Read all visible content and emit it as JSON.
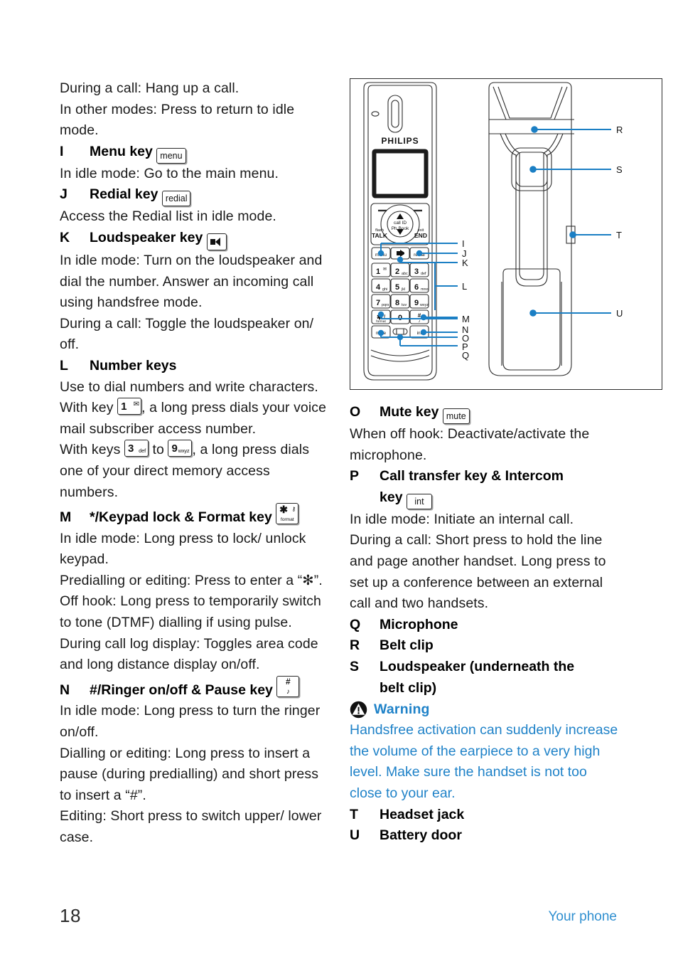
{
  "page": {
    "number": "18",
    "footer_section": "Your phone",
    "accent_blue": "#1f82c8",
    "footer_blue": "#2f8fd0"
  },
  "left_column": {
    "intro": [
      "During a call: Hang up a call.",
      "In other modes: Press to return to idle mode."
    ],
    "entries": [
      {
        "letter": "I",
        "title": "Menu key",
        "key_label": "menu",
        "key_type": "word",
        "body": [
          "In idle mode: Go to the main menu."
        ]
      },
      {
        "letter": "J",
        "title": "Redial key",
        "key_label": "redial",
        "key_type": "word",
        "body": [
          "Access the Redial list in idle mode."
        ]
      },
      {
        "letter": "K",
        "title": "Loudspeaker key",
        "key_label": "speaker-icon",
        "key_type": "speaker",
        "body": [
          "In idle mode: Turn on the loudspeaker and dial the number. Answer an incoming call using handsfree mode.",
          "During a call: Toggle the loudspeaker on/ off."
        ]
      },
      {
        "letter": "L",
        "title": "Number keys",
        "key_label": "",
        "key_type": "none",
        "body": [
          "Use to dial numbers and write characters."
        ],
        "rich": {
          "line1_a": "With key",
          "line1_b": ", a long press dials your voice mail subscriber access number.",
          "key1_digit": "1",
          "key1_sub": "voicemail-envelope",
          "line2_a": "With keys",
          "line2_mid": "to",
          "line2_b": ", a long press dials one of your direct memory access numbers.",
          "key3_digit": "3",
          "key3_sub": "def",
          "key9_digit": "9",
          "key9_sub": "wxyz"
        }
      },
      {
        "letter": "M",
        "title": "*/Keypad lock & Format key",
        "key_label": "format",
        "key_type": "star-format",
        "key_star": "✱",
        "body": [
          "In idle mode: Long press to lock/ unlock keypad.",
          "Predialling or editing: Press to enter a “✻”.",
          "Off hook: Long press to temporarily switch to tone (DTMF) dialling if using pulse.",
          "During call log display: Toggles area code and long distance display on/off."
        ]
      },
      {
        "letter": "N",
        "title": "#/Ringer on/off & Pause key",
        "key_label": "#",
        "key_type": "hash-bell",
        "body": [
          "In idle mode: Long press to turn the ringer on/off.",
          "Dialling or editing: Long press to insert a pause (during predialling) and short press to insert a “#”.",
          "Editing: Short press to switch upper/ lower case."
        ]
      }
    ]
  },
  "right_column": {
    "entries": [
      {
        "letter": "O",
        "title": "Mute key",
        "key_label": "mute",
        "key_type": "word",
        "body": [
          "When off hook: Deactivate/activate the microphone."
        ]
      },
      {
        "letter": "P",
        "title": "Call transfer key & Intercom",
        "title_line2": "key",
        "key_label": "int",
        "key_type": "word",
        "body": [
          "In idle mode: Initiate an internal call.",
          "During a call: Short press to hold the line and page another handset. Long press to set up a conference between an external call and two handsets."
        ]
      },
      {
        "letter": "Q",
        "title": "Microphone",
        "key_type": "none",
        "body": []
      },
      {
        "letter": "R",
        "title": "Belt clip",
        "key_type": "none",
        "body": []
      },
      {
        "letter": "S",
        "title": "Loudspeaker (underneath the",
        "title_line2": "belt clip)",
        "key_type": "none",
        "body": []
      }
    ],
    "warning": {
      "icon": "warning-triangle-icon",
      "title": "Warning",
      "text": "Handsfree activation can suddenly increase the volume of the earpiece to a very high level. Make sure the handset is not too close to your ear."
    },
    "entries_after_warning": [
      {
        "letter": "T",
        "title": "Headset jack"
      },
      {
        "letter": "U",
        "title": "Battery door"
      }
    ]
  },
  "figure": {
    "brand": "PHILIPS",
    "soft_keys": {
      "left": "flash TALK",
      "right": "exit END"
    },
    "nav_labels": {
      "up": "call ID",
      "down": "Ph.Book"
    },
    "function_row": [
      "menu",
      "speaker-icon",
      "redial"
    ],
    "keypad": [
      {
        "digit": "1",
        "sub": "envelope"
      },
      {
        "digit": "2",
        "sub": "abc"
      },
      {
        "digit": "3",
        "sub": "def"
      },
      {
        "digit": "4",
        "sub": "ghi"
      },
      {
        "digit": "5",
        "sub": "jkl"
      },
      {
        "digit": "6",
        "sub": "mno"
      },
      {
        "digit": "7",
        "sub": "pqrs"
      },
      {
        "digit": "8",
        "sub": "tuv"
      },
      {
        "digit": "9",
        "sub": "wxyz"
      }
    ],
    "bottom_rows": [
      {
        "digit": "✱",
        "sub": "format"
      },
      {
        "digit": "0",
        "sub": ""
      },
      {
        "digit": "#",
        "sub": "ringer"
      }
    ],
    "last_row": [
      "mute",
      "microphone-icon",
      "int"
    ],
    "callouts_front": [
      "I",
      "J",
      "K",
      "L",
      "M",
      "N",
      "O",
      "P",
      "Q"
    ],
    "callouts_back": [
      "R",
      "S",
      "T",
      "U"
    ],
    "callout_color": "#1b7fc4"
  }
}
